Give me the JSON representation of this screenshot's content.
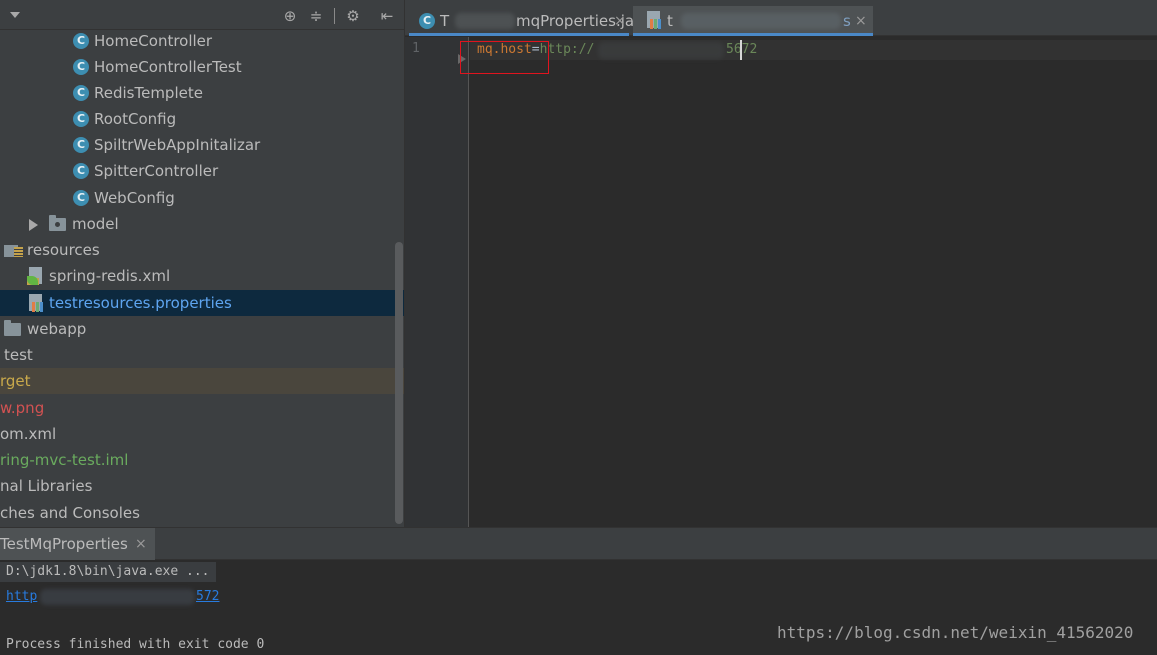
{
  "project_tree": {
    "items": [
      {
        "label": "HomeController",
        "icon": "class-icon",
        "color": "#bbbbbb"
      },
      {
        "label": "HomeControllerTest",
        "icon": "class-icon",
        "color": "#bbbbbb"
      },
      {
        "label": "RedisTemplete",
        "icon": "class-icon",
        "color": "#bbbbbb"
      },
      {
        "label": "RootConfig",
        "icon": "class-icon",
        "color": "#bbbbbb"
      },
      {
        "label": "SpiltrWebAppInitalizar",
        "icon": "class-icon",
        "color": "#bbbbbb"
      },
      {
        "label": "SpitterController",
        "icon": "class-icon",
        "color": "#bbbbbb"
      },
      {
        "label": "WebConfig",
        "icon": "class-icon",
        "color": "#bbbbbb"
      },
      {
        "label": "model",
        "icon": "package-folder-icon",
        "color": "#bbbbbb"
      },
      {
        "label": "resources",
        "icon": "resources-folder-icon",
        "color": "#bbbbbb"
      },
      {
        "label": "spring-redis.xml",
        "icon": "spring-xml-icon",
        "color": "#bbbbbb"
      },
      {
        "label": "testresources.properties",
        "icon": "properties-file-icon",
        "color": "#5ea5f0"
      },
      {
        "label": "webapp",
        "icon": "folder-icon",
        "color": "#bbbbbb"
      },
      {
        "label": "test",
        "icon": "none",
        "color": "#bbbbbb"
      },
      {
        "label": "rget",
        "icon": "none",
        "color": "#c9a94b"
      },
      {
        "label": "w.png",
        "icon": "none",
        "color": "#d25252"
      },
      {
        "label": "om.xml",
        "icon": "none",
        "color": "#bbbbbb"
      },
      {
        "label": "ring-mvc-test.iml",
        "icon": "none",
        "color": "#6aab5e"
      },
      {
        "label": "nal Libraries",
        "icon": "none",
        "color": "#bbbbbb"
      },
      {
        "label": "ches and Consoles",
        "icon": "none",
        "color": "#bbbbbb"
      }
    ]
  },
  "toolbar": {
    "icons": [
      "locate-icon",
      "collapse-icon",
      "gear-icon",
      "hide-icon"
    ]
  },
  "tabs": [
    {
      "label_prefix": "T",
      "label_suffix": "mqProperties.java",
      "icon": "class-icon",
      "close": "×"
    },
    {
      "label_prefix": "t",
      "label_suffix": "s",
      "icon": "properties-file-icon",
      "close": "×"
    }
  ],
  "editor": {
    "line_number": "1",
    "key": "mq.host",
    "eq": "=",
    "value_prefix": "http://",
    "value_suffix": "5672"
  },
  "run_panel": {
    "tab_label": "TestMqProperties",
    "tab_close": "×",
    "command": "D:\\jdk1.8\\bin\\java.exe ...",
    "url_prefix": "http",
    "url_suffix": "572",
    "exit_message": "Process finished with exit code 0"
  },
  "watermark": "https://blog.csdn.net/weixin_41562020"
}
